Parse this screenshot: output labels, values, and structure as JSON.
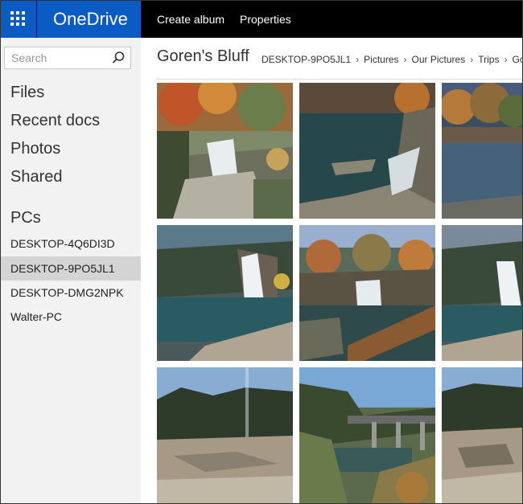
{
  "app": {
    "name": "OneDrive"
  },
  "commands": {
    "create_album": "Create album",
    "properties": "Properties"
  },
  "search": {
    "placeholder": "Search"
  },
  "nav": [
    {
      "label": "Files"
    },
    {
      "label": "Recent docs"
    },
    {
      "label": "Photos"
    },
    {
      "label": "Shared"
    }
  ],
  "pcs": {
    "heading": "PCs",
    "items": [
      {
        "label": "DESKTOP-4Q6DI3D",
        "selected": false
      },
      {
        "label": "DESKTOP-9PO5JL1",
        "selected": true
      },
      {
        "label": "DESKTOP-DMG2NPK",
        "selected": false
      },
      {
        "label": "Walter-PC",
        "selected": false
      }
    ]
  },
  "folder": {
    "title": "Goren's Bluff",
    "breadcrumb": [
      "DESKTOP-9PO5JL1",
      "Pictures",
      "Our Pictures",
      "Trips",
      "Gor"
    ]
  },
  "colors": {
    "accent": "#0a5bc4",
    "topbar": "#000000",
    "sidebar": "#f2f2f2",
    "selected": "#d4d4d4"
  },
  "photos": [
    {
      "name": "waterfall-autumn-cliff"
    },
    {
      "name": "pool-below-falls"
    },
    {
      "name": "lake-with-trees"
    },
    {
      "name": "tall-waterfall"
    },
    {
      "name": "falls-with-railing"
    },
    {
      "name": "waterfall-partial"
    },
    {
      "name": "rock-ledge-forest"
    },
    {
      "name": "bridge-over-river"
    },
    {
      "name": "rocky-overlook"
    }
  ]
}
